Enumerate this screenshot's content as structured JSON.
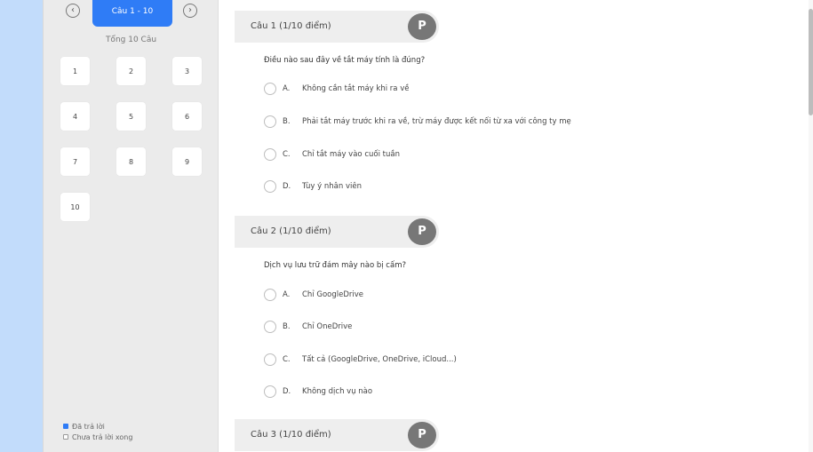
{
  "sidebar": {
    "prev_icon": "chevron-left-circle-icon",
    "next_icon": "chevron-right-circle-icon",
    "prev_glyph": "‹",
    "next_glyph": "›",
    "range_label": "Câu 1 - 10",
    "total_label": "Tổng 10 Câu",
    "question_numbers": [
      "1",
      "2",
      "3",
      "4",
      "5",
      "6",
      "7",
      "8",
      "9",
      "10"
    ],
    "legend": {
      "answered": "Đã trả lời",
      "unanswered": "Chưa trả lời xong"
    }
  },
  "questions": [
    {
      "title": "Câu 1 (1/10 điểm)",
      "flag_label": "P",
      "text": "Điều nào sau đây về tắt máy tính là đúng?",
      "options": [
        {
          "letter": "A.",
          "text": "Không cần tắt máy khi ra về"
        },
        {
          "letter": "B.",
          "text": "Phải tắt máy trước khi ra về, trừ máy được kết nối từ xa với công ty mẹ"
        },
        {
          "letter": "C.",
          "text": "Chỉ tắt máy vào cuối tuần"
        },
        {
          "letter": "D.",
          "text": "Tùy ý nhân viên"
        }
      ]
    },
    {
      "title": "Câu 2 (1/10 điểm)",
      "flag_label": "P",
      "text": "Dịch vụ lưu trữ đám mây nào bị cấm?",
      "options": [
        {
          "letter": "A.",
          "text": "Chỉ GoogleDrive"
        },
        {
          "letter": "B.",
          "text": "Chỉ OneDrive"
        },
        {
          "letter": "C.",
          "text": "Tất cả (GoogleDrive, OneDrive, iCloud...)"
        },
        {
          "letter": "D.",
          "text": "Không dịch vụ nào"
        }
      ]
    },
    {
      "title": "Câu 3 (1/10 điểm)",
      "flag_label": "P"
    }
  ],
  "colors": {
    "accent": "#2f7cf6",
    "background": "#c2dcfb"
  }
}
